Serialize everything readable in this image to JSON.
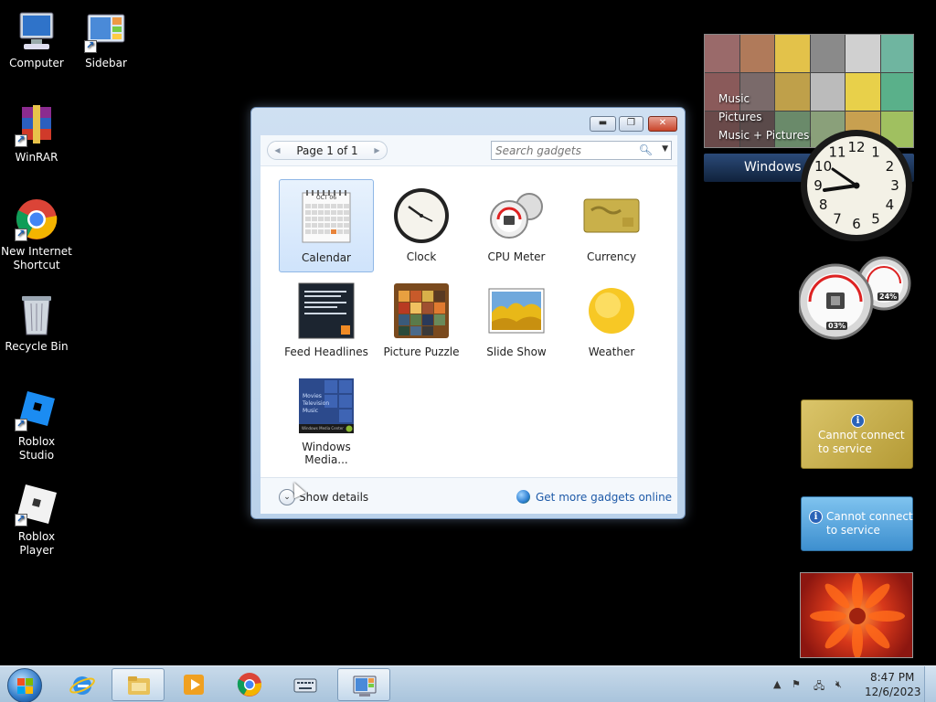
{
  "desktop": {
    "icons": [
      {
        "label": "Computer"
      },
      {
        "label": "Sidebar"
      },
      {
        "label": "WinRAR"
      },
      {
        "label": "New Internet Shortcut"
      },
      {
        "label": "Recycle Bin"
      },
      {
        "label": "Roblox Studio"
      },
      {
        "label": "Roblox Player"
      }
    ]
  },
  "gadget_gallery": {
    "pager": {
      "text": "Page 1 of 1"
    },
    "search": {
      "placeholder": "Search gadgets"
    },
    "gadgets": [
      {
        "name": "Calendar",
        "selected": true
      },
      {
        "name": "Clock"
      },
      {
        "name": "CPU Meter"
      },
      {
        "name": "Currency"
      },
      {
        "name": "Feed Headlines"
      },
      {
        "name": "Picture Puzzle"
      },
      {
        "name": "Slide Show"
      },
      {
        "name": "Weather"
      },
      {
        "name": "Windows Media..."
      }
    ],
    "calendar_month": "OCT 06",
    "media_thumb_lines": [
      "Movies",
      "Television",
      "Music"
    ],
    "media_thumb_footer": "Windows Media Center",
    "footer": {
      "details_label": "Show details",
      "more_link": "Get more gadgets online"
    }
  },
  "sidebar": {
    "media_items": [
      "Music",
      "Pictures",
      "Music + Pictures"
    ],
    "media_bar_label": "Windows",
    "clock_numbers": [
      "12",
      "1",
      "2",
      "3",
      "4",
      "5",
      "6",
      "7",
      "8",
      "9",
      "10",
      "11"
    ],
    "cpu_values": {
      "cpu": "03%",
      "memory": "24%"
    },
    "currency_error": "Cannot connect to service",
    "feed_error": "Cannot connect to service",
    "info_glyph": "i"
  },
  "taskbar": {
    "time": "8:47 PM",
    "date": "12/6/2023"
  },
  "colors": {
    "window_frame": "#b9d1ea",
    "taskbar": "#a9c4dc",
    "link": "#1e5aa8",
    "close_button": "#c9442a"
  }
}
